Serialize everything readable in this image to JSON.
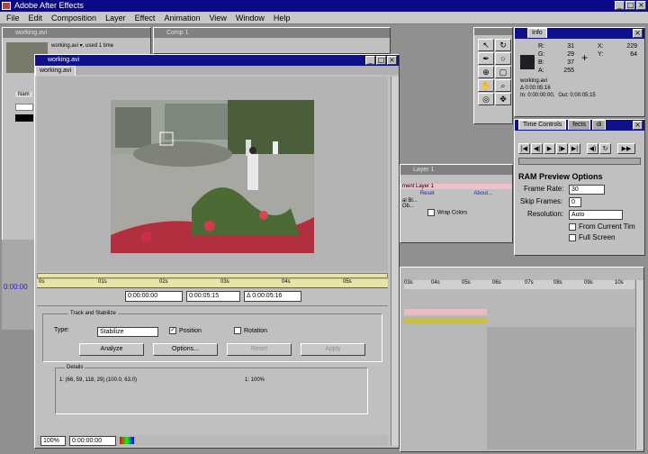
{
  "app": {
    "title": "Adobe After Effects",
    "win_minimize": "_",
    "win_maximize": "□",
    "win_close": "×"
  },
  "menu": [
    "File",
    "Edit",
    "Composition",
    "Layer",
    "Effect",
    "Animation",
    "View",
    "Window",
    "Help"
  ],
  "project": {
    "title": "working.avi",
    "info": "working.avi ▾, used 1 time",
    "col_name": "Nam"
  },
  "comp": {
    "title": "Comp 1"
  },
  "footage": {
    "title": "working.avi",
    "tab": "working.avi",
    "ruler_ticks": [
      "0s",
      "01s",
      "02s",
      "03s",
      "04s",
      "05s"
    ],
    "time_current": "0:00:00:00",
    "time_out": "0:00:05:15",
    "time_duration": "Δ 0:00:05:16",
    "zoom": "100%",
    "time_bottom": "0:00:00:00"
  },
  "tracker": {
    "group_label": "Track and Stabilize",
    "type_label": "Type:",
    "type_value": "Stabilize",
    "position_label": "Position",
    "position_checked": true,
    "rotation_label": "Rotation",
    "rotation_checked": false,
    "analyze_label": "Analyze",
    "options_label": "Options...",
    "reset_label": "Reset",
    "apply_label": "Apply",
    "details_label": "Details",
    "details_coords": "1: (66, 59, 118, 29) (100.0, 63.0)",
    "details_pct": "1: 100%"
  },
  "effects": {
    "title": "Layer 1",
    "layer_label": "ment Layer 1",
    "reset": "Reset",
    "about": "About...",
    "row1": "al Bl...",
    "row2": "Ob...",
    "wrap_label": "Wrap Colors"
  },
  "info_panel": {
    "tab": "Info",
    "r": "R:",
    "g": "G:",
    "b": "B:",
    "a": "A:",
    "r_val": "31",
    "g_val": "29",
    "b_val": "37",
    "a_val": "255",
    "x": "X:",
    "y": "Y:",
    "x_val": "229",
    "y_val": "64",
    "file": "working.avi",
    "delta": "Δ 0:00:05:16",
    "in_time": "In: 0:00:00:00,",
    "out_time": "Out: 0:00:05:15"
  },
  "time_controls": {
    "tab1": "Time Controls",
    "tab2": "fects",
    "tab3": "di"
  },
  "ram_preview": {
    "title": "RAM Preview Options",
    "frame_rate_label": "Frame Rate:",
    "frame_rate_value": "30",
    "skip_label": "Skip Frames:",
    "skip_value": "0",
    "resolution_label": "Resolution:",
    "resolution_value": "Auto",
    "from_current_label": "From Current Tim",
    "full_screen_label": "Full Screen"
  },
  "timeline": {
    "ticks": [
      "03s",
      "04s",
      "05s",
      "06s",
      "07s",
      "08s",
      "09s",
      "10s"
    ],
    "time": "0:00:00"
  },
  "colors": {
    "titlebar": "#0a0a88",
    "inactive_title": "#808080",
    "panel": "#c0c0c0",
    "work_area": "#e8e4a8",
    "timeline_pink": "#f0b8c0",
    "timeline_olive": "#c8c040"
  }
}
